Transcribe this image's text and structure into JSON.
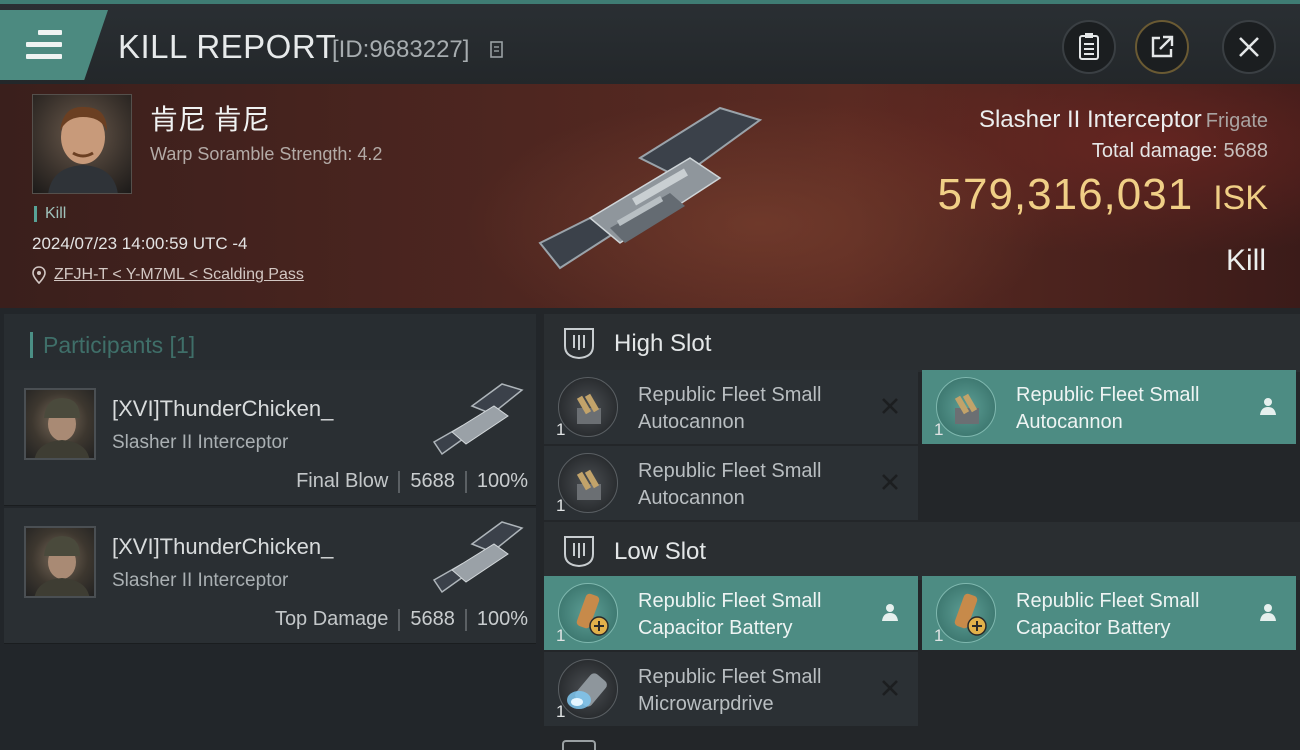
{
  "header": {
    "title": "KILL REPORT",
    "report_id": "[ID:9683227]",
    "icons": [
      "menu-icon",
      "copy-icon",
      "clipboard-icon",
      "share-icon",
      "close-icon"
    ]
  },
  "victim": {
    "name": "肯尼 肯尼",
    "warp_strength": "Warp Soramble Strength: 4.2",
    "tag": "Kill",
    "timestamp": "2024/07/23 14:00:59 UTC -4",
    "location": "ZFJH-T < Y-M7ML < Scalding Pass",
    "ship_name": "Slasher II Interceptor",
    "ship_class": "Frigate",
    "total_damage_label": "Total damage:",
    "total_damage_value": "5688",
    "isk_value": "579,316,031",
    "isk_unit": "ISK",
    "result": "Kill"
  },
  "participants": {
    "title": "Participants [1]",
    "rows": [
      {
        "name": "[XVI]ThunderChicken_",
        "ship": "Slasher II Interceptor",
        "label": "Final Blow",
        "damage": "5688",
        "percent": "100%"
      },
      {
        "name": "[XVI]ThunderChicken_",
        "ship": "Slasher II Interceptor",
        "label": "Top Damage",
        "damage": "5688",
        "percent": "100%"
      }
    ]
  },
  "slots": {
    "high": {
      "label": "High Slot",
      "modules": [
        {
          "name": "Republic Fleet Small Autocannon",
          "qty": "1",
          "status": "destroyed"
        },
        {
          "name": "Republic Fleet Small Autocannon",
          "qty": "1",
          "status": "dropped"
        },
        {
          "name": "Republic Fleet Small Autocannon",
          "qty": "1",
          "status": "destroyed"
        }
      ]
    },
    "low": {
      "label": "Low Slot",
      "modules": [
        {
          "name": "Republic Fleet Small Capacitor Battery",
          "qty": "1",
          "status": "dropped"
        },
        {
          "name": "Republic Fleet Small Capacitor Battery",
          "qty": "1",
          "status": "dropped"
        },
        {
          "name": "Republic Fleet Small Microwarpdrive",
          "qty": "1",
          "status": "destroyed"
        }
      ]
    }
  },
  "colors": {
    "accent": "#4d8c83",
    "isk": "#f0cf86",
    "banner": "#4e2620"
  }
}
